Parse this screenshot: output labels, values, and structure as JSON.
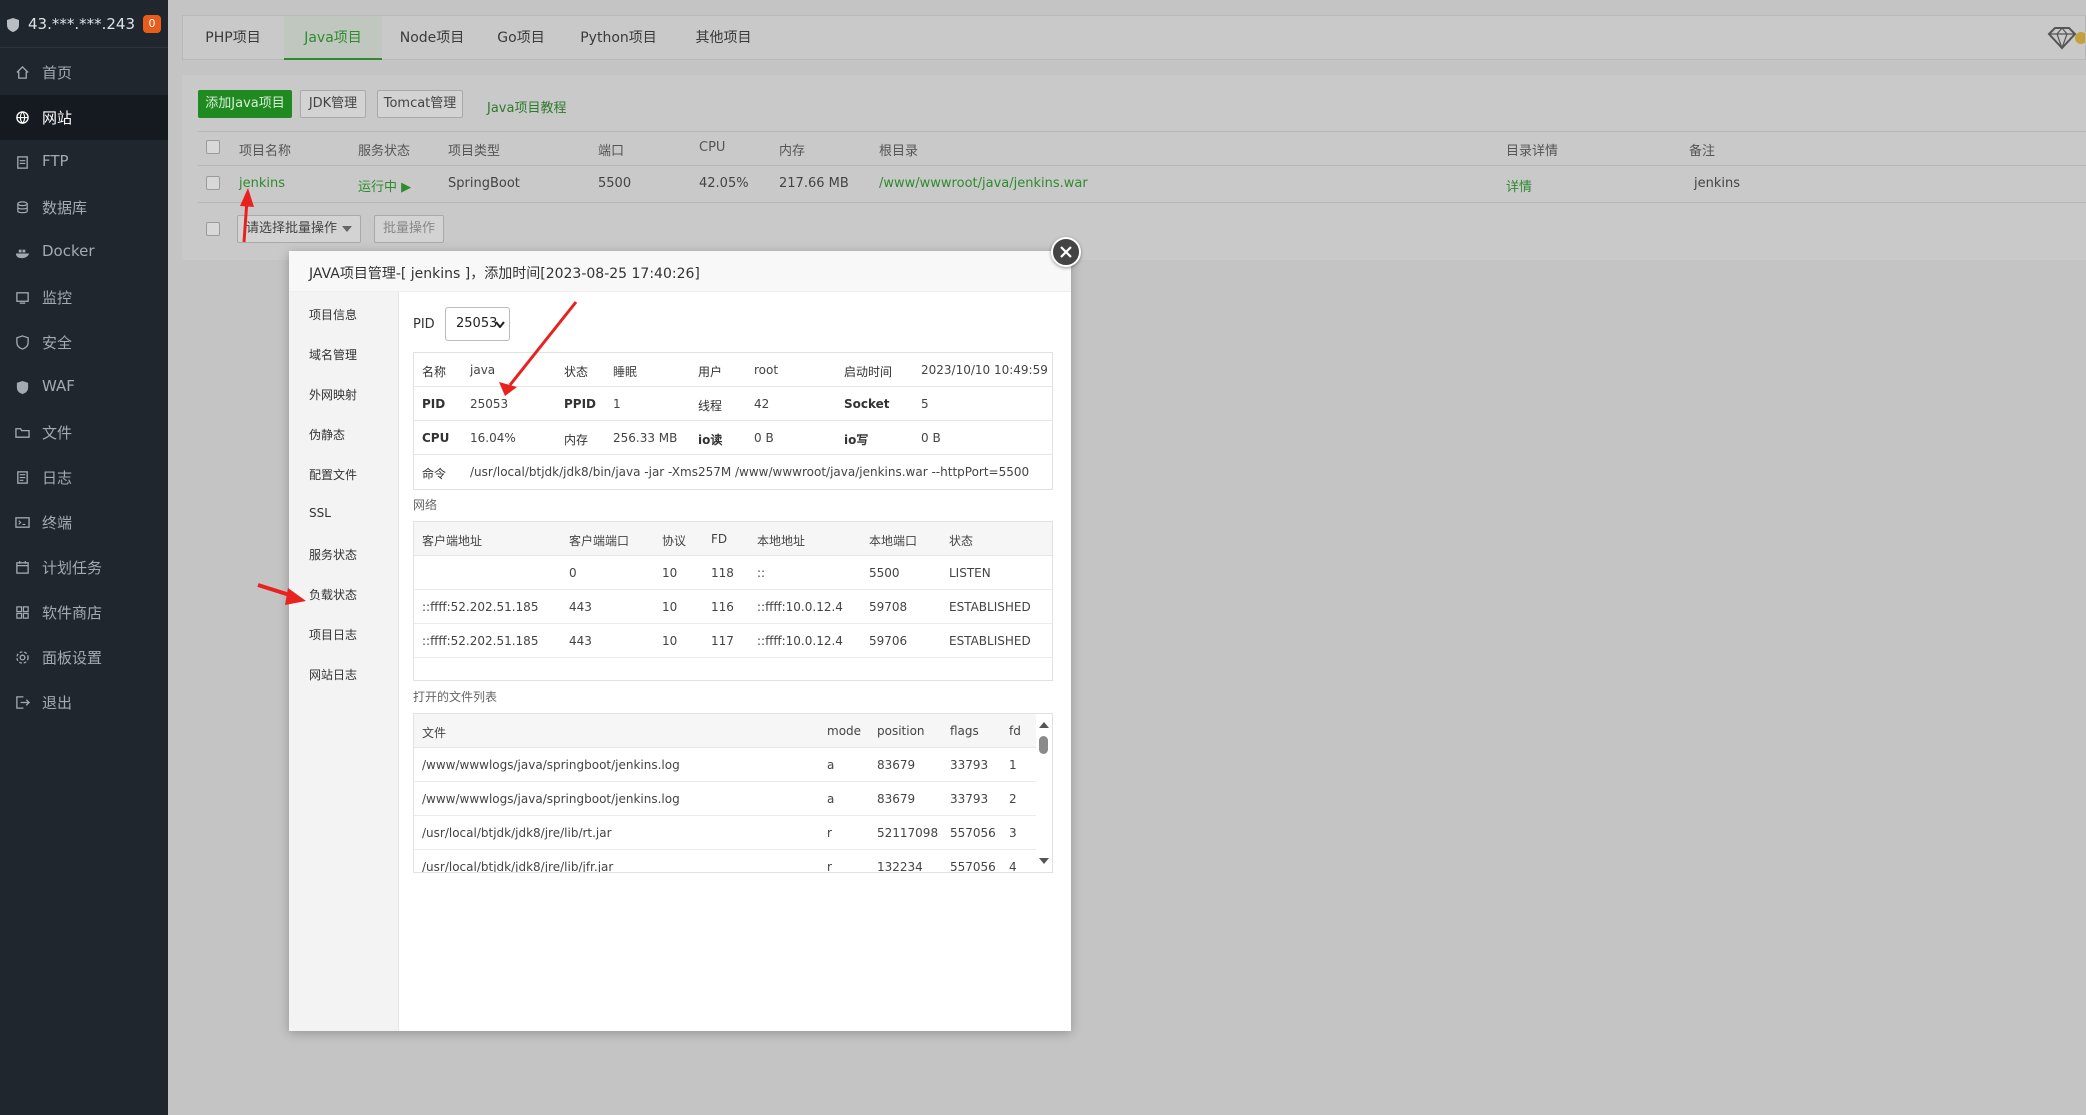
{
  "sidebar": {
    "server_ip": "43.***.***.243",
    "badge": "0",
    "items": [
      {
        "label": "首页",
        "icon": "home-icon"
      },
      {
        "label": "网站",
        "icon": "globe-icon"
      },
      {
        "label": "FTP",
        "icon": "ftp-icon"
      },
      {
        "label": "数据库",
        "icon": "database-icon"
      },
      {
        "label": "Docker",
        "icon": "docker-icon"
      },
      {
        "label": "监控",
        "icon": "monitor-icon"
      },
      {
        "label": "安全",
        "icon": "shield-icon"
      },
      {
        "label": "WAF",
        "icon": "waf-icon"
      },
      {
        "label": "文件",
        "icon": "folder-icon"
      },
      {
        "label": "日志",
        "icon": "log-icon"
      },
      {
        "label": "终端",
        "icon": "terminal-icon"
      },
      {
        "label": "计划任务",
        "icon": "calendar-icon"
      },
      {
        "label": "软件商店",
        "icon": "apps-icon"
      },
      {
        "label": "面板设置",
        "icon": "gear-icon"
      },
      {
        "label": "退出",
        "icon": "logout-icon"
      }
    ]
  },
  "tabs": [
    "PHP项目",
    "Java项目",
    "Node项目",
    "Go项目",
    "Python项目",
    "其他项目"
  ],
  "toolbar": {
    "add_java": "添加Java项目",
    "jdk": "JDK管理",
    "tomcat": "Tomcat管理",
    "tutorial": "Java项目教程"
  },
  "project_table": {
    "headers": [
      "项目名称",
      "服务状态",
      "项目类型",
      "端口",
      "CPU",
      "内存",
      "根目录",
      "目录详情",
      "备注"
    ],
    "row": {
      "name": "jenkins",
      "status": "运行中 ▶",
      "type": "SpringBoot",
      "port": "5500",
      "cpu": "42.05%",
      "mem": "217.66 MB",
      "root": "/www/wwwroot/java/jenkins.war",
      "detail": "详情",
      "note": "jenkins"
    },
    "batch_placeholder": "请选择批量操作",
    "batch_button": "批量操作"
  },
  "modal": {
    "title": "JAVA项目管理-[ jenkins ]，添加时间[2023-08-25 17:40:26]",
    "menu": [
      "项目信息",
      "域名管理",
      "外网映射",
      "伪静态",
      "配置文件",
      "SSL",
      "服务状态",
      "负载状态",
      "项目日志",
      "网站日志"
    ],
    "pid_label": "PID",
    "pid_value": "25053",
    "info": {
      "name_k": "名称",
      "name_v": "java",
      "state_k": "状态",
      "state_v": "睡眠",
      "user_k": "用户",
      "user_v": "root",
      "start_k": "启动时间",
      "start_v": "2023/10/10 10:49:59",
      "pid_k": "PID",
      "pid_v": "25053",
      "ppid_k": "PPID",
      "ppid_v": "1",
      "threads_k": "线程",
      "threads_v": "42",
      "socket_k": "Socket",
      "socket_v": "5",
      "cpu_k": "CPU",
      "cpu_v": "16.04%",
      "mem_k": "内存",
      "mem_v": "256.33 MB",
      "ioread_k": "io读",
      "ioread_v": "0 B",
      "iowrite_k": "io写",
      "iowrite_v": "0 B",
      "cmd_k": "命令",
      "cmd_v": "/usr/local/btjdk/jdk8/bin/java -jar -Xms257M /www/wwwroot/java/jenkins.war --httpPort=5500"
    },
    "network_title": "网络",
    "network_headers": [
      "客户端地址",
      "客户端端口",
      "协议",
      "FD",
      "本地地址",
      "本地端口",
      "状态"
    ],
    "network_rows": [
      [
        "",
        "0",
        "10",
        "118",
        "::",
        "5500",
        "LISTEN"
      ],
      [
        "::ffff:52.202.51.185",
        "443",
        "10",
        "116",
        "::ffff:10.0.12.4",
        "59708",
        "ESTABLISHED"
      ],
      [
        "::ffff:52.202.51.185",
        "443",
        "10",
        "117",
        "::ffff:10.0.12.4",
        "59706",
        "ESTABLISHED"
      ]
    ],
    "files_title": "打开的文件列表",
    "files_headers": [
      "文件",
      "mode",
      "position",
      "flags",
      "fd"
    ],
    "files_rows": [
      [
        "/www/wwwlogs/java/springboot/jenkins.log",
        "a",
        "83679",
        "33793",
        "1"
      ],
      [
        "/www/wwwlogs/java/springboot/jenkins.log",
        "a",
        "83679",
        "33793",
        "2"
      ],
      [
        "/usr/local/btjdk/jdk8/jre/lib/rt.jar",
        "r",
        "52117098",
        "557056",
        "3"
      ],
      [
        "/usr/local/btjdk/jdk8/jre/lib/jfr.jar",
        "r",
        "132234",
        "557056",
        "4"
      ]
    ]
  },
  "colors": {
    "sidebar_bg": "#20262e",
    "accent_green": "#20a53a",
    "annotation_red": "#e8231f"
  }
}
